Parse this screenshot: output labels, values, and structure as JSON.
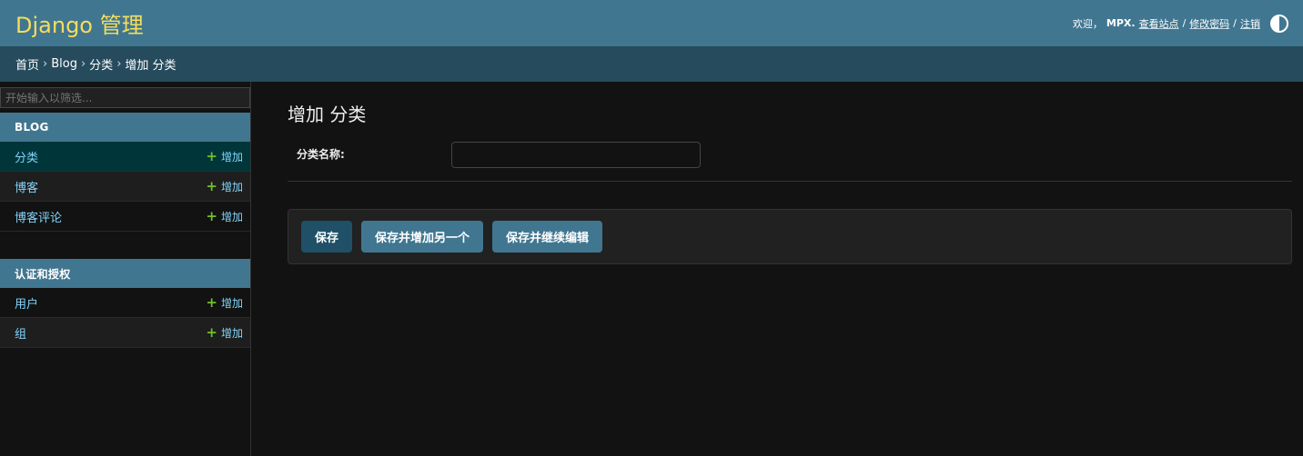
{
  "header": {
    "site_name": "Django 管理",
    "welcome": "欢迎，",
    "user": "MPX.",
    "view_site": "查看站点",
    "sep": "/",
    "change_password": "修改密码",
    "logout": "注销"
  },
  "breadcrumbs": {
    "home": "首页",
    "app": "Blog",
    "model": "分类",
    "current": "增加 分类",
    "arrow": "›"
  },
  "sidebar": {
    "filter_placeholder": "开始输入以筛选...",
    "modules": [
      {
        "caption": "BLOG",
        "rows": [
          {
            "name": "分类",
            "add": "增加"
          },
          {
            "name": "博客",
            "add": "增加"
          },
          {
            "name": "博客评论",
            "add": "增加"
          }
        ]
      },
      {
        "caption": "认证和授权",
        "rows": [
          {
            "name": "用户",
            "add": "增加"
          },
          {
            "name": "组",
            "add": "增加"
          }
        ]
      }
    ],
    "plus": "+"
  },
  "content": {
    "title": "增加 分类",
    "field_label": "分类名称:",
    "field_value": "",
    "buttons": {
      "save": "保存",
      "save_add_another": "保存并增加另一个",
      "save_continue": "保存并继续编辑"
    }
  },
  "colors": {
    "header_bg": "#417690",
    "breadcrumbs_bg": "#264b5d",
    "site_name": "#f5dd5d",
    "link": "#81d4fa",
    "add_plus": "#70bf2b",
    "active_row": "#00363a"
  }
}
